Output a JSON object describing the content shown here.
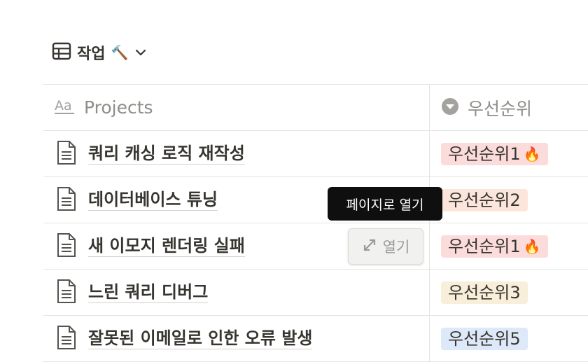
{
  "view": {
    "title": "작업",
    "emoji": "🔨"
  },
  "table": {
    "columns": [
      {
        "label": "Projects",
        "icon": "text-aa-icon"
      },
      {
        "label": "우선순위",
        "icon": "select-property-icon"
      }
    ],
    "rows": [
      {
        "name": "쿼리 캐싱 로직 재작성",
        "priority": "우선순위1",
        "emoji": "🔥",
        "color": "#fbdcdb"
      },
      {
        "name": "데이터베이스 튜닝",
        "priority": "우선순위2",
        "emoji": "",
        "color": "#fce6dc"
      },
      {
        "name": "새 이모지 렌더링 실패",
        "priority": "우선순위1",
        "emoji": "🔥",
        "color": "#fbdcdb"
      },
      {
        "name": "느린 쿼리 디버그",
        "priority": "우선순위3",
        "emoji": "",
        "color": "#f9eeda"
      },
      {
        "name": "잘못된 이메일로 인한 오류 발생",
        "priority": "우선순위5",
        "emoji": "",
        "color": "#dde8f8"
      }
    ]
  },
  "tooltip": {
    "text": "페이지로 열기"
  },
  "open_button": {
    "label": "열기",
    "icon": "expand-arrows-icon"
  }
}
